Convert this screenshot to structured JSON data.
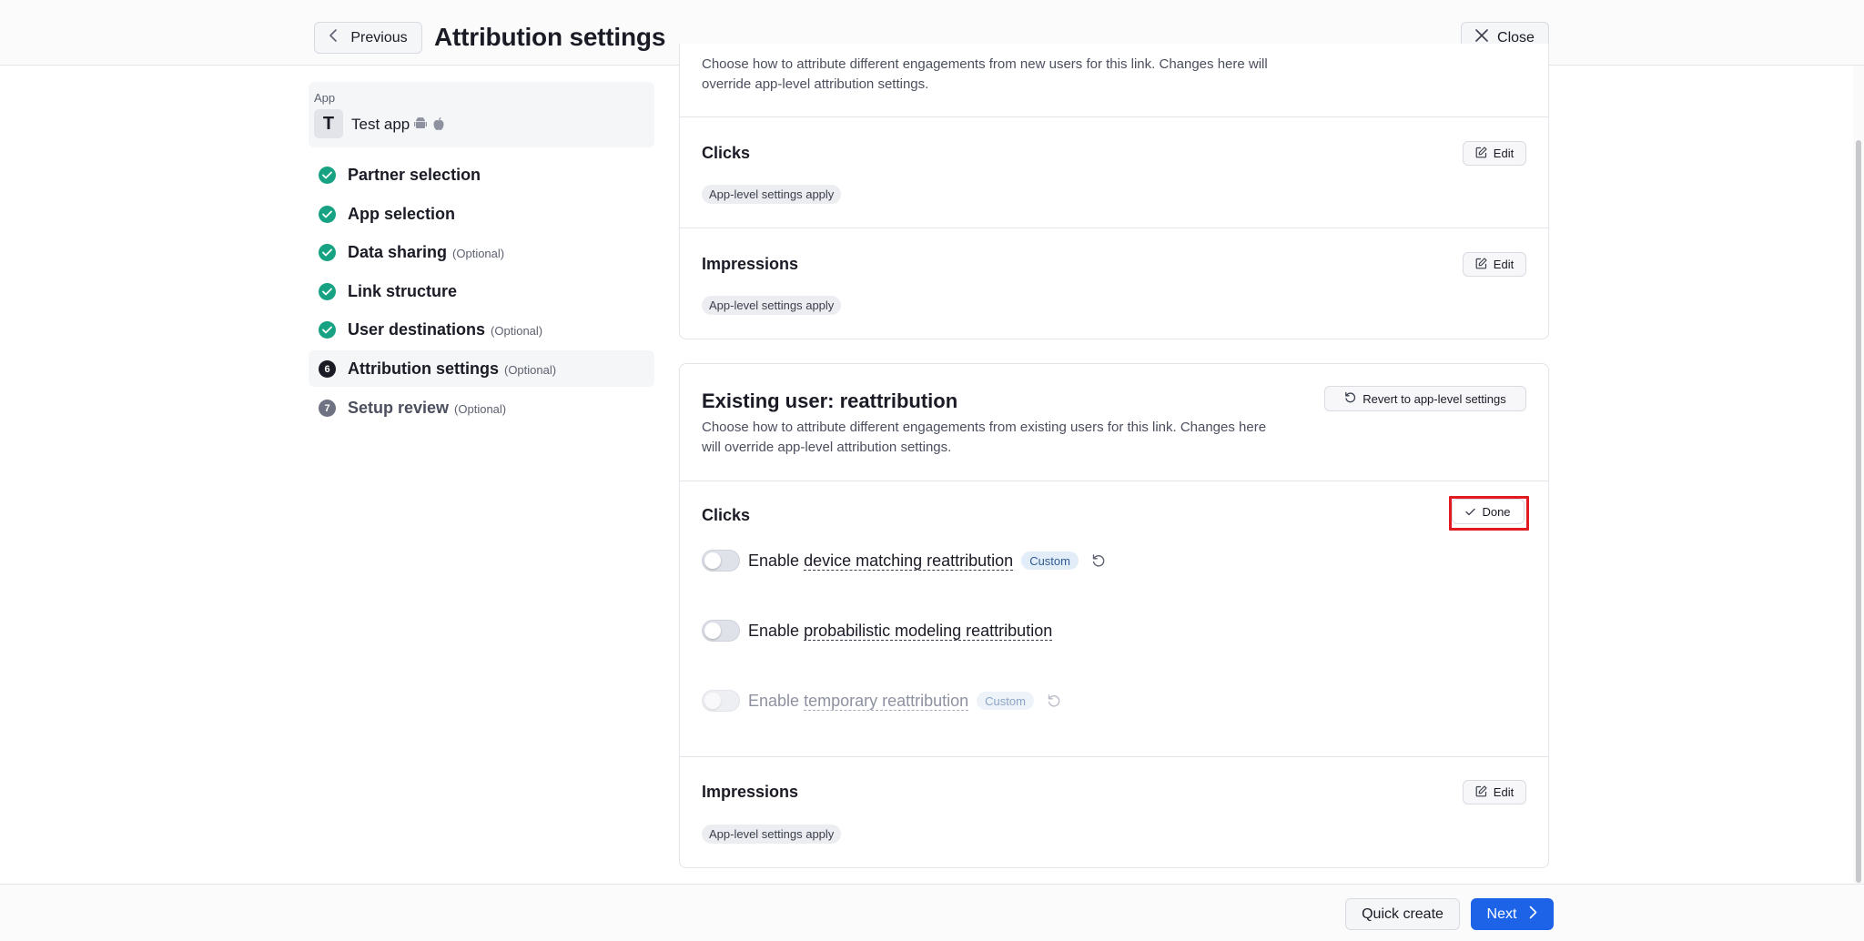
{
  "header": {
    "previous_label": "Previous",
    "title": "Attribution settings",
    "close_label": "Close"
  },
  "app": {
    "label": "App",
    "avatar_letter": "T",
    "name": "Test app",
    "platforms": [
      "android-icon",
      "apple-icon"
    ]
  },
  "steps": [
    {
      "label": "Partner selection",
      "optional": "",
      "status": "done"
    },
    {
      "label": "App selection",
      "optional": "",
      "status": "done"
    },
    {
      "label": "Data sharing",
      "optional": "(Optional)",
      "status": "done"
    },
    {
      "label": "Link structure",
      "optional": "",
      "status": "done"
    },
    {
      "label": "User destinations",
      "optional": "(Optional)",
      "status": "done"
    },
    {
      "label": "Attribution settings",
      "optional": "(Optional)",
      "status": "current",
      "number": "6"
    },
    {
      "label": "Setup review",
      "optional": "(Optional)",
      "status": "upcoming",
      "number": "7"
    }
  ],
  "new_user_card": {
    "description_line1": "Choose how to attribute different engagements from new users for this link. Changes here will",
    "description_line2": "override app-level attribution settings.",
    "clicks": {
      "title": "Clicks",
      "edit_label": "Edit",
      "badge": "App-level settings apply"
    },
    "impressions": {
      "title": "Impressions",
      "edit_label": "Edit",
      "badge": "App-level settings apply"
    }
  },
  "existing_user_card": {
    "title": "Existing user: reattribution",
    "revert_label": "Revert to app-level settings",
    "description_line1": "Choose how to attribute different engagements from existing users for this link. Changes here",
    "description_line2": "will override app-level attribution settings.",
    "clicks": {
      "title": "Clicks",
      "done_label": "Done",
      "toggles": [
        {
          "prefix": "Enable ",
          "term": "device matching reattribution",
          "badge": "Custom",
          "enabled": false,
          "disabled": false
        },
        {
          "prefix": "Enable ",
          "term": "probabilistic modeling reattribution",
          "badge": "",
          "enabled": false,
          "disabled": false
        },
        {
          "prefix": "Enable ",
          "term": "temporary reattribution",
          "badge": "Custom",
          "enabled": false,
          "disabled": true
        }
      ]
    },
    "impressions": {
      "title": "Impressions",
      "edit_label": "Edit",
      "badge": "App-level settings apply"
    }
  },
  "footer": {
    "quick_create_label": "Quick create",
    "next_label": "Next"
  },
  "colors": {
    "accent": "#1d63e8",
    "success": "#17a383",
    "highlight": "#e21b23"
  }
}
